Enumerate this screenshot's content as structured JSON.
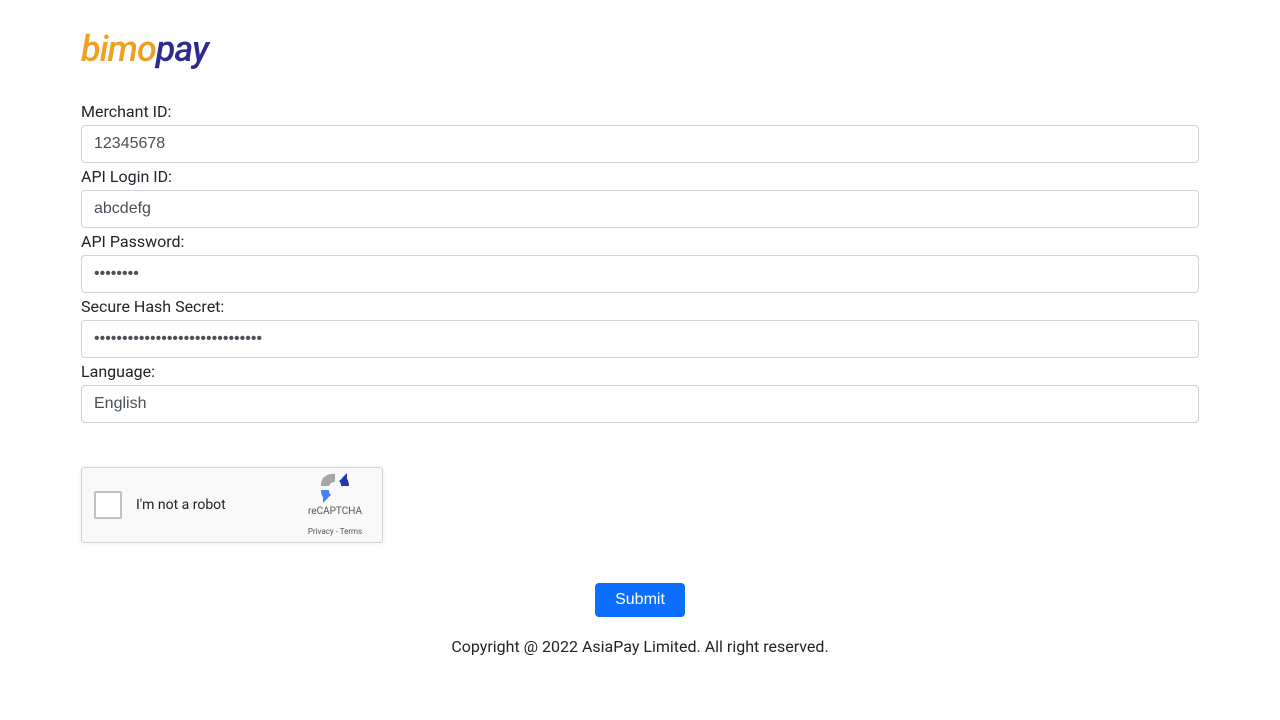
{
  "logo": {
    "part1": "bimo",
    "part2": "pay"
  },
  "form": {
    "merchant_id": {
      "label": "Merchant ID:",
      "value": "12345678"
    },
    "api_login_id": {
      "label": "API Login ID:",
      "value": "abcdefg"
    },
    "api_password": {
      "label": "API Password:",
      "value": "••••••••"
    },
    "secure_hash_secret": {
      "label": "Secure Hash Secret:",
      "value": "••••••••••••••••••••••••••••••"
    },
    "language": {
      "label": "Language:",
      "value": "English"
    }
  },
  "recaptcha": {
    "label": "I'm not a robot",
    "brand": "reCAPTCHA",
    "privacy": "Privacy",
    "terms": "Terms"
  },
  "submit_label": "Submit",
  "footer": "Copyright @ 2022 AsiaPay Limited. All right reserved."
}
